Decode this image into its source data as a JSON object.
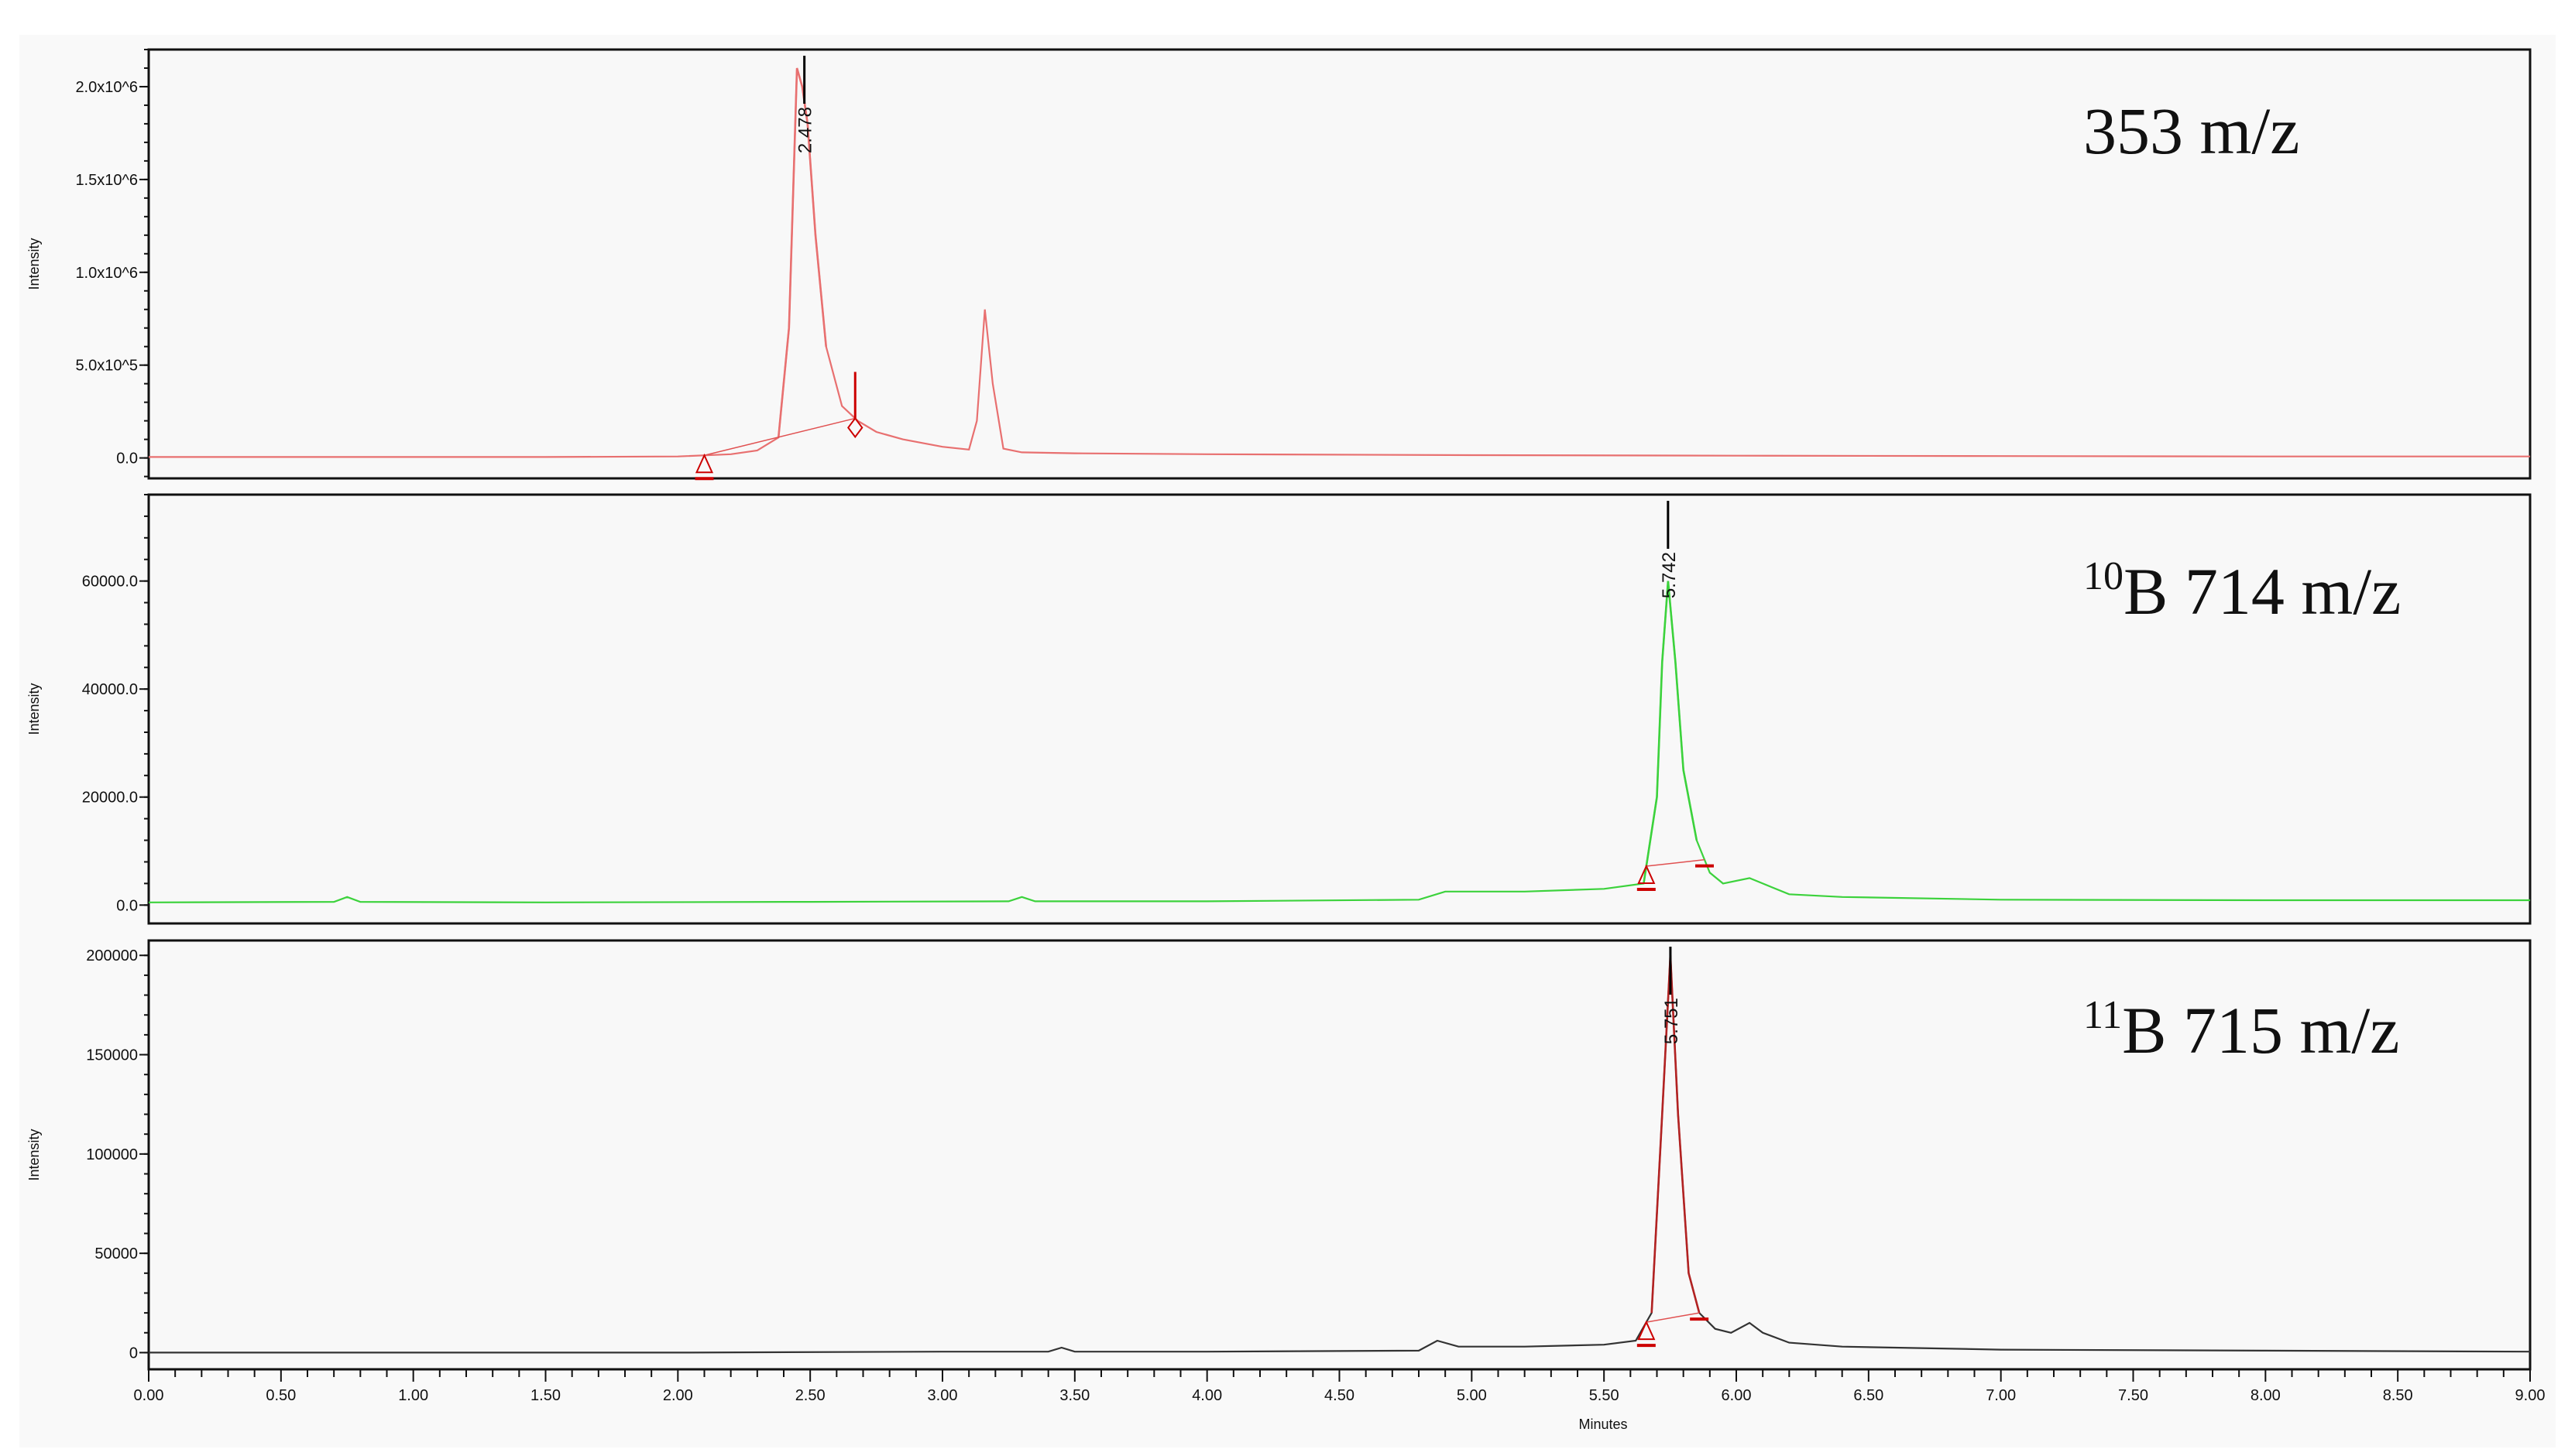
{
  "chart_data": [
    {
      "type": "line",
      "title": "353 m/z",
      "title_sup": "",
      "title_main": "353 m/z",
      "ylabel": "Intensity",
      "xlabel": "Minutes",
      "xlim": [
        0,
        9
      ],
      "ylim": [
        -110000,
        2200000
      ],
      "yticks": [
        0,
        500000,
        1000000,
        1500000,
        2000000
      ],
      "ytick_labels": [
        "0.0",
        "5.0x10^5",
        "1.0x10^6",
        "1.5x10^6",
        "2.0x10^6"
      ],
      "color": "#e87070",
      "peak_color": "#e87070",
      "peak": {
        "x": 2.478,
        "label": "2.478",
        "color": "#000000"
      },
      "integration_marks": [
        {
          "x": 2.1,
          "shape": "triangle"
        },
        {
          "x": 2.67,
          "shape": "diamond"
        }
      ],
      "series": {
        "x": [
          0,
          0.5,
          1,
          1.5,
          2,
          2.2,
          2.3,
          2.38,
          2.42,
          2.45,
          2.47,
          2.49,
          2.52,
          2.56,
          2.62,
          2.68,
          2.75,
          2.85,
          3.0,
          3.1,
          3.13,
          3.16,
          3.19,
          3.23,
          3.3,
          3.5,
          4,
          5,
          6,
          7,
          8,
          9
        ],
        "y": [
          5000,
          5000,
          5000,
          5000,
          8000,
          20000,
          40000,
          110000,
          700000,
          2100000,
          2000000,
          1800000,
          1200000,
          600000,
          280000,
          200000,
          140000,
          100000,
          60000,
          45000,
          200000,
          800000,
          400000,
          50000,
          30000,
          25000,
          20000,
          15000,
          12000,
          10000,
          8000,
          8000
        ]
      }
    },
    {
      "type": "line",
      "title": "10B 714 m/z",
      "title_sup": "10",
      "title_main": "B 714 m/z",
      "ylabel": "Intensity",
      "xlabel": "Minutes",
      "xlim": [
        0,
        9
      ],
      "ylim": [
        -3400,
        76000
      ],
      "yticks": [
        0,
        20000,
        40000,
        60000
      ],
      "ytick_labels": [
        "0.0",
        "20000.0",
        "40000.0",
        "60000.0"
      ],
      "color": "#3cd23c",
      "peak_color": "#3cd23c",
      "peak": {
        "x": 5.742,
        "label": "5.742",
        "color": "#000000"
      },
      "integration_marks": [
        {
          "x": 5.66,
          "shape": "triangle"
        },
        {
          "x": 5.88,
          "shape": "bar"
        }
      ],
      "series": {
        "x": [
          0,
          0.7,
          0.75,
          0.8,
          1.5,
          2.5,
          3.25,
          3.3,
          3.35,
          4,
          4.8,
          4.9,
          5.2,
          5.5,
          5.65,
          5.7,
          5.72,
          5.742,
          5.77,
          5.8,
          5.85,
          5.9,
          5.95,
          6.05,
          6.1,
          6.2,
          6.4,
          7,
          8,
          9
        ],
        "y": [
          500,
          600,
          1500,
          600,
          500,
          600,
          700,
          1500,
          700,
          700,
          1000,
          2500,
          2500,
          3000,
          4000,
          20000,
          45000,
          60000,
          45000,
          25000,
          12000,
          6000,
          4000,
          5000,
          4000,
          2000,
          1500,
          1000,
          900,
          900
        ]
      }
    },
    {
      "type": "line",
      "title": "11B 715 m/z",
      "title_sup": "11",
      "title_main": "B 715 m/z",
      "ylabel": "Intensity",
      "xlabel": "Minutes",
      "xlim": [
        0,
        9
      ],
      "ylim": [
        -8400,
        207500
      ],
      "yticks": [
        0,
        50000,
        100000,
        150000,
        200000
      ],
      "ytick_labels": [
        "0",
        "50000",
        "100000",
        "150000",
        "200000"
      ],
      "color": "#333333",
      "peak_color": "#b22222",
      "peak": {
        "x": 5.751,
        "label": "5.751",
        "color": "#000000"
      },
      "integration_marks": [
        {
          "x": 5.66,
          "shape": "triangle"
        },
        {
          "x": 5.86,
          "shape": "bar"
        }
      ],
      "series": {
        "x": [
          0,
          1,
          2,
          3,
          3.4,
          3.45,
          3.5,
          4,
          4.8,
          4.87,
          4.95,
          5.2,
          5.5,
          5.62,
          5.68,
          5.72,
          5.751,
          5.78,
          5.82,
          5.86,
          5.92,
          5.98,
          6.05,
          6.1,
          6.2,
          6.4,
          7,
          8,
          9
        ],
        "y": [
          0,
          0,
          0,
          500,
          500,
          2500,
          500,
          500,
          1000,
          6000,
          3000,
          3000,
          4000,
          6000,
          20000,
          120000,
          200000,
          120000,
          40000,
          20000,
          12000,
          10000,
          15000,
          10000,
          5000,
          3000,
          1500,
          1000,
          500
        ]
      }
    }
  ],
  "xaxis": {
    "ticks": [
      0,
      0.5,
      1,
      1.5,
      2,
      2.5,
      3,
      3.5,
      4,
      4.5,
      5,
      5.5,
      6,
      6.5,
      7,
      7.5,
      8,
      8.5,
      9
    ],
    "tick_labels": [
      "0.00",
      "0.50",
      "1.00",
      "1.50",
      "2.00",
      "2.50",
      "3.00",
      "3.50",
      "4.00",
      "4.50",
      "5.00",
      "5.50",
      "6.00",
      "6.50",
      "7.00",
      "7.50",
      "8.00",
      "8.50",
      "9.00"
    ],
    "label": "Minutes"
  }
}
